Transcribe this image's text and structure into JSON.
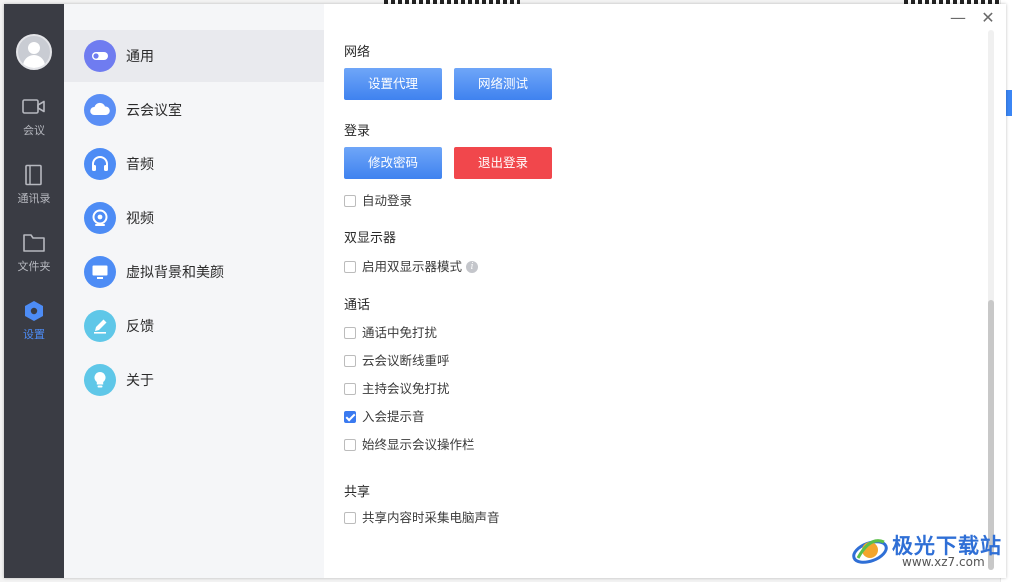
{
  "window": {
    "minimize_glyph": "—",
    "close_glyph": "✕"
  },
  "rail": {
    "items": [
      {
        "label": "会议",
        "icon": "video-camera-icon"
      },
      {
        "label": "通讯录",
        "icon": "contacts-book-icon"
      },
      {
        "label": "文件夹",
        "icon": "folder-icon"
      },
      {
        "label": "设置",
        "icon": "settings-hexagon-icon",
        "active": true
      }
    ]
  },
  "nav": {
    "items": [
      {
        "label": "通用",
        "icon": "toggle-icon",
        "color": "#6f7cf0",
        "active": true
      },
      {
        "label": "云会议室",
        "icon": "cloud-icon",
        "color": "#5a8ef5"
      },
      {
        "label": "音频",
        "icon": "headphones-icon",
        "color": "#4d8cf5"
      },
      {
        "label": "视频",
        "icon": "webcam-icon",
        "color": "#4d8cf5"
      },
      {
        "label": "虚拟背景和美颜",
        "icon": "monitor-icon",
        "color": "#4d8cf5"
      },
      {
        "label": "反馈",
        "icon": "pencil-icon",
        "color": "#5fc7e8"
      },
      {
        "label": "关于",
        "icon": "lightbulb-icon",
        "color": "#5fc7e8"
      }
    ]
  },
  "content": {
    "network": {
      "title": "网络",
      "proxy_button": "设置代理",
      "test_button": "网络测试"
    },
    "login": {
      "title": "登录",
      "change_password_button": "修改密码",
      "logout_button": "退出登录",
      "auto_login": {
        "label": "自动登录",
        "checked": false
      }
    },
    "dual_display": {
      "title": "双显示器",
      "enable": {
        "label": "启用双显示器模式",
        "checked": false
      },
      "info_glyph": "i"
    },
    "call": {
      "title": "通话",
      "options": [
        {
          "label": "通话中免打扰",
          "checked": false
        },
        {
          "label": "云会议断线重呼",
          "checked": false
        },
        {
          "label": "主持会议免打扰",
          "checked": false
        },
        {
          "label": "入会提示音",
          "checked": true
        },
        {
          "label": "始终显示会议操作栏",
          "checked": false
        }
      ]
    },
    "share": {
      "title": "共享",
      "capture_audio": {
        "label": "共享内容时采集电脑声音",
        "checked": false
      }
    }
  },
  "watermark": {
    "title": "极光下载站",
    "url": "www.xz7.com"
  },
  "colors": {
    "accent": "#3f82ef",
    "danger": "#f1474c",
    "rail_bg": "#3a3c44",
    "nav_bg": "#f5f6f8"
  }
}
